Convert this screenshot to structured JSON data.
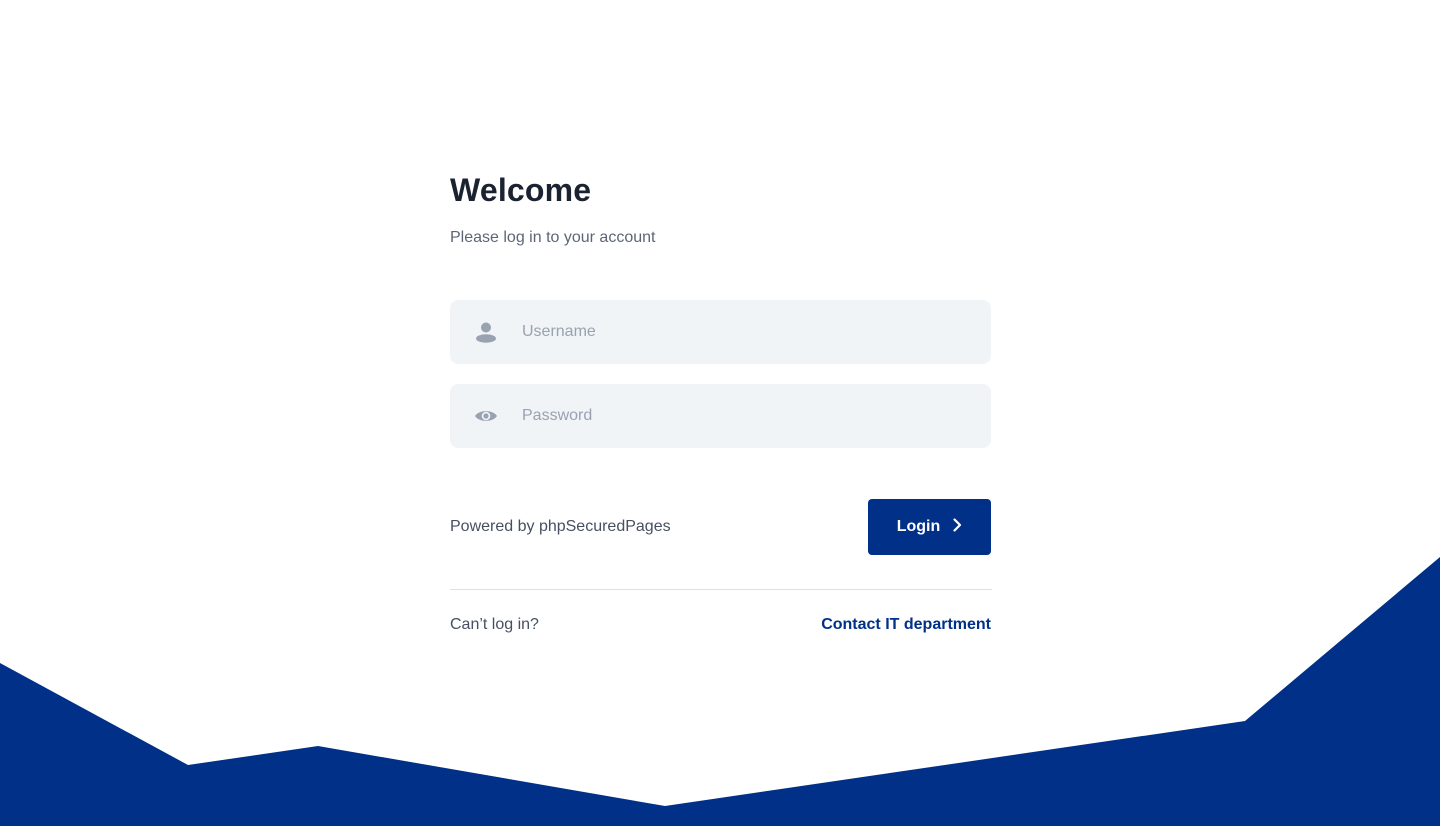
{
  "header": {
    "title": "Welcome",
    "subtitle": "Please log in to your account"
  },
  "form": {
    "username": {
      "value": "",
      "placeholder": "Username",
      "icon": "user-icon"
    },
    "password": {
      "value": "",
      "placeholder": "Password",
      "icon": "eye-icon"
    },
    "powered_by": "Powered by phpSecuredPages",
    "login_label": "Login",
    "login_icon": "chevron-right-icon"
  },
  "footer": {
    "cant_login": "Can’t log in?",
    "contact_link": "Contact IT department"
  },
  "colors": {
    "brand": "#003087",
    "field_bg": "#f1f4f7",
    "title": "#1b2230",
    "muted": "#5d6677"
  }
}
